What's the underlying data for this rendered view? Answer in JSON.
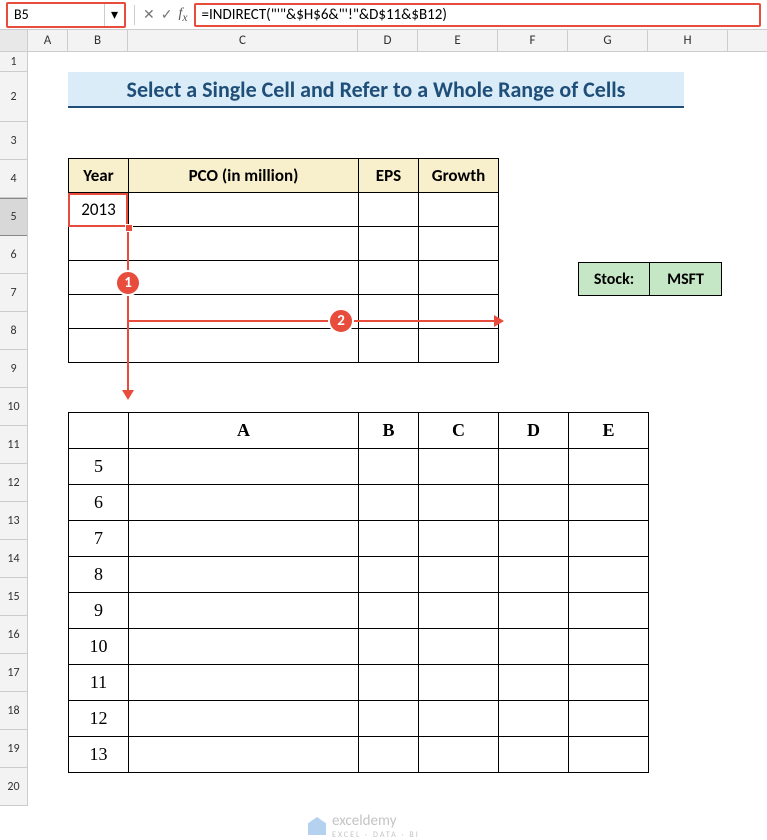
{
  "namebox": {
    "value": "B5"
  },
  "formula_bar": {
    "value": "=INDIRECT(\"'\"&$H$6&\"'!\"&D$11&$B12)"
  },
  "columns": [
    "A",
    "B",
    "C",
    "D",
    "E",
    "F",
    "G",
    "H"
  ],
  "rows": [
    "1",
    "2",
    "3",
    "4",
    "5",
    "6",
    "7",
    "8",
    "9",
    "10",
    "11",
    "12",
    "13",
    "14",
    "15",
    "16",
    "17",
    "18",
    "19",
    "20"
  ],
  "title": "Select a Single Cell and Refer to a Whole Range of Cells",
  "table1": {
    "headers": {
      "year": "Year",
      "pco": "PCO (in million)",
      "eps": "EPS",
      "growth": "Growth"
    },
    "rows": [
      {
        "year": "2013",
        "pco": "",
        "eps": "",
        "growth": ""
      },
      {
        "year": "",
        "pco": "",
        "eps": "",
        "growth": ""
      },
      {
        "year": "",
        "pco": "",
        "eps": "",
        "growth": ""
      },
      {
        "year": "",
        "pco": "",
        "eps": "",
        "growth": ""
      },
      {
        "year": "",
        "pco": "",
        "eps": "",
        "growth": ""
      }
    ]
  },
  "stock": {
    "label": "Stock:",
    "value": "MSFT"
  },
  "markers": {
    "m1": "1",
    "m2": "2"
  },
  "table2": {
    "headers": [
      "",
      "A",
      "B",
      "C",
      "D",
      "E"
    ],
    "rows": [
      [
        "5",
        "",
        "",
        "",
        "",
        ""
      ],
      [
        "6",
        "",
        "",
        "",
        "",
        ""
      ],
      [
        "7",
        "",
        "",
        "",
        "",
        ""
      ],
      [
        "8",
        "",
        "",
        "",
        "",
        ""
      ],
      [
        "9",
        "",
        "",
        "",
        "",
        ""
      ],
      [
        "10",
        "",
        "",
        "",
        "",
        ""
      ],
      [
        "11",
        "",
        "",
        "",
        "",
        ""
      ],
      [
        "12",
        "",
        "",
        "",
        "",
        ""
      ],
      [
        "13",
        "",
        "",
        "",
        "",
        ""
      ]
    ]
  },
  "watermark": {
    "brand": "exceldemy",
    "sub": "EXCEL · DATA · BI"
  },
  "icons": {
    "dropdown": "▾",
    "cancel": "✕",
    "confirm": "✓"
  }
}
